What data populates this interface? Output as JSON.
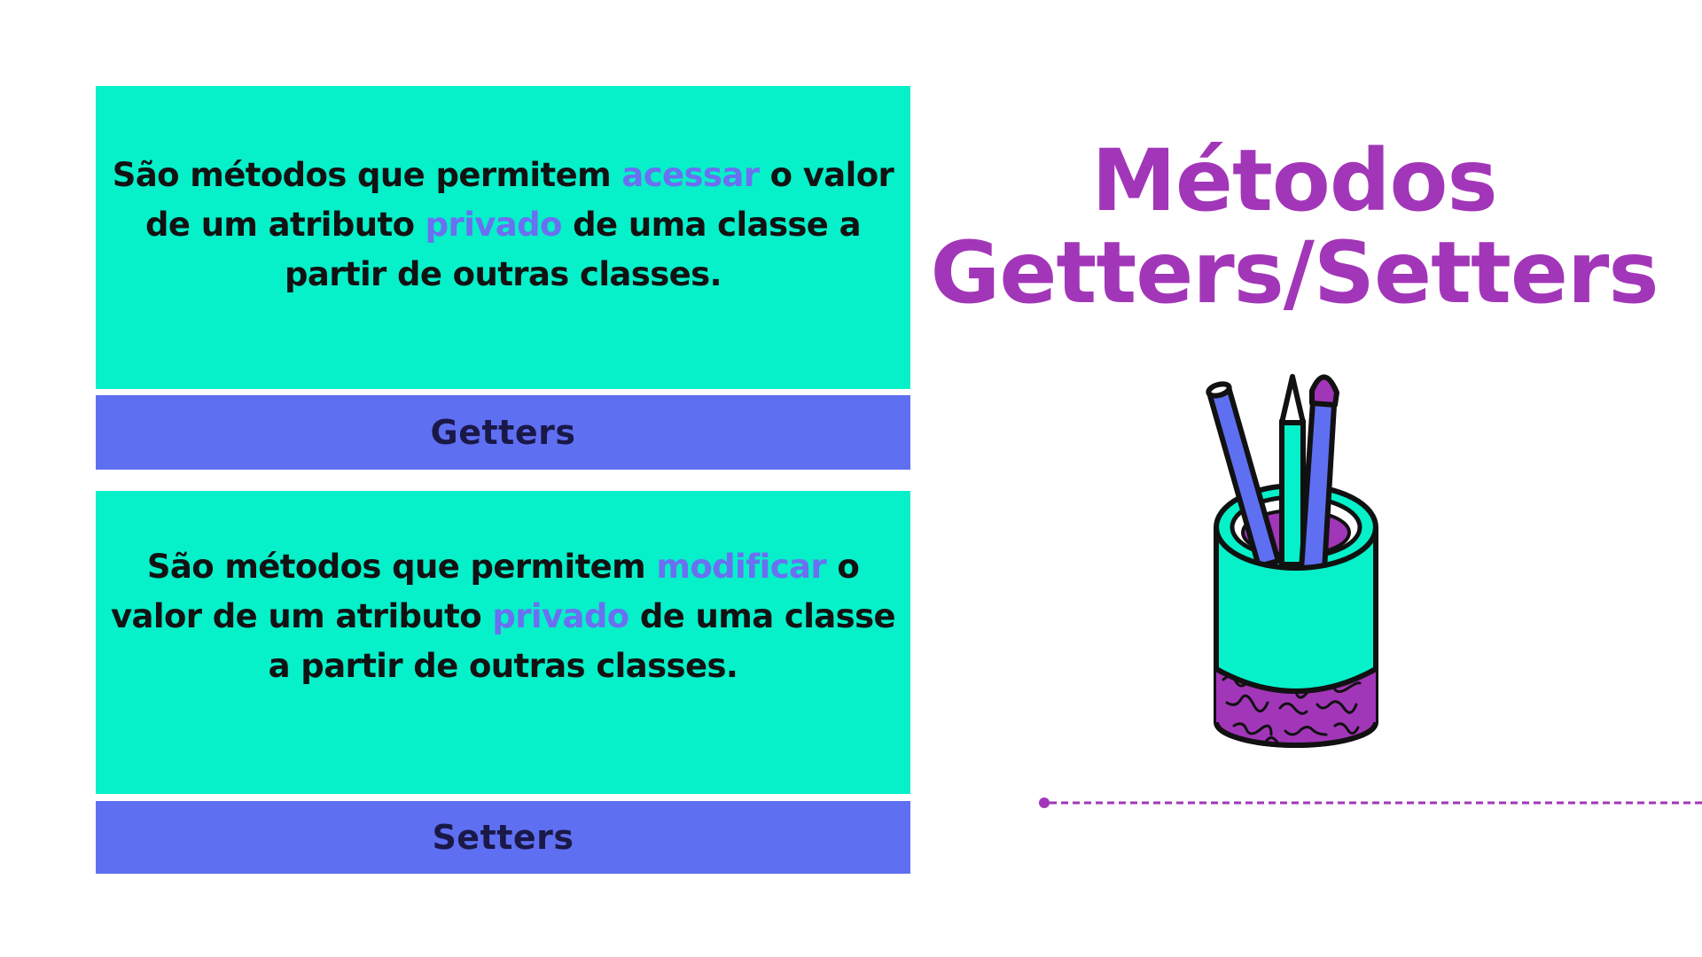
{
  "title": {
    "line1": "Métodos",
    "line2": "Getters/Setters"
  },
  "getters": {
    "desc_before_1": "São métodos que permitem ",
    "desc_highlight_1": "acessar",
    "desc_after_1": " o valor de um atributo ",
    "desc_highlight_2": "privado",
    "desc_after_2": " de uma classe a partir de outras classes.",
    "label": "Getters"
  },
  "setters": {
    "desc_before_1": "São métodos que permitem ",
    "desc_highlight_1": "modificar",
    "desc_after_1": " o valor de um atributo ",
    "desc_highlight_2": "privado",
    "desc_after_2": " de uma classe a partir de outras classes.",
    "label": "Setters"
  },
  "illustration": {
    "icon": "pencil-cup-icon"
  },
  "colors": {
    "background": "#ffffff",
    "card": "#06f0c9",
    "label_bar": "#5f6ff2",
    "label_text": "#1a1847",
    "highlight": "#6b6ff2",
    "title": "#a236b8",
    "body_text": "#121212"
  }
}
